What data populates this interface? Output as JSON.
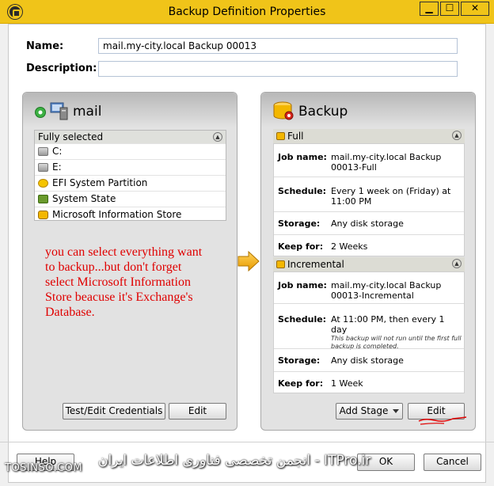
{
  "window": {
    "title": "Backup Definition Properties",
    "controls": {
      "minimize": "▁",
      "maximize": "☐",
      "close": "✕"
    }
  },
  "form": {
    "name_label": "Name:",
    "name_value": "mail.my-city.local Backup 00013",
    "description_label": "Description:",
    "description_value": ""
  },
  "source": {
    "title": "mail",
    "list_header": "Fully selected",
    "items": [
      {
        "label": "C:",
        "icon": "drive-icon"
      },
      {
        "label": "E:",
        "icon": "drive-icon"
      },
      {
        "label": "EFI System Partition",
        "icon": "efi-icon"
      },
      {
        "label": "System State",
        "icon": "system-state-icon"
      },
      {
        "label": "Microsoft Information Store",
        "icon": "information-store-icon"
      }
    ],
    "annotation": "you can select everything want to backup...but don't forget select Microsoft Information Store beacuse it's Exchange's Database.",
    "buttons": {
      "credentials": "Test/Edit Credentials",
      "edit": "Edit"
    }
  },
  "backup": {
    "title": "Backup",
    "full": {
      "header": "Full",
      "job_label": "Job name:",
      "job_value": "mail.my-city.local Backup 00013-Full",
      "schedule_label": "Schedule:",
      "schedule_value": "Every 1 week on (Friday) at 11:00 PM",
      "storage_label": "Storage:",
      "storage_value": "Any disk storage",
      "keep_label": "Keep for:",
      "keep_value": "2 Weeks"
    },
    "incremental": {
      "header": "Incremental",
      "job_label": "Job name:",
      "job_value": "mail.my-city.local Backup 00013-Incremental",
      "schedule_label": "Schedule:",
      "schedule_value": "At 11:00 PM, then every 1 day",
      "schedule_note": "This backup will not run until the first full backup is completed.",
      "storage_label": "Storage:",
      "storage_value": "Any disk storage",
      "keep_label": "Keep for:",
      "keep_value": "1 Week"
    },
    "buttons": {
      "add_stage": "Add Stage",
      "edit": "Edit"
    }
  },
  "footer": {
    "help": "Help",
    "ok": "OK",
    "cancel": "Cancel"
  },
  "watermark": {
    "site": "TOSINSO.COM",
    "text": "انجمن تخصصی فناوری اطلاعات ایران - ITPro.ir"
  },
  "colors": {
    "titlebar": "#f0c419",
    "annotation": "#e00000",
    "scribble": "#e00000"
  }
}
